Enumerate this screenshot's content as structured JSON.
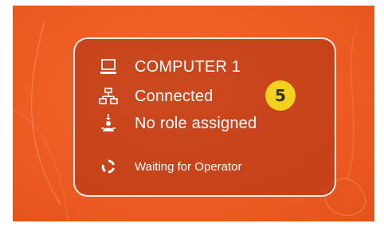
{
  "panel": {
    "computer_name": "COMPUTER 1",
    "connection_status": "Connected",
    "role_status": "No role assigned",
    "waiting_text": "Waiting for Operator",
    "badge_number": "5"
  },
  "icons": {
    "computer": "monitor-icon",
    "network": "network-icon",
    "role": "person-role-icon",
    "waiting": "spinner-icon"
  },
  "colors": {
    "background": "#ec5b22",
    "badge": "#f3d21f",
    "text": "#ffffff"
  }
}
